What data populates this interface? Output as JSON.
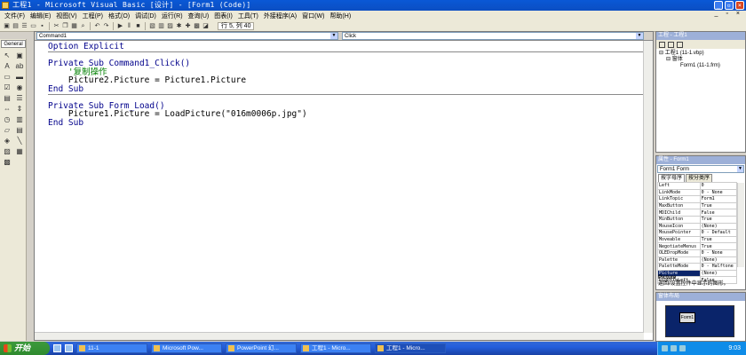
{
  "window": {
    "title": "工程1 - Microsoft Visual Basic [设计] - [Form1 (Code)]"
  },
  "menu": [
    "文件(F)",
    "编辑(E)",
    "视图(V)",
    "工程(P)",
    "格式(O)",
    "调试(D)",
    "运行(R)",
    "查询(U)",
    "图表(I)",
    "工具(T)",
    "外接程序(A)",
    "窗口(W)",
    "帮助(H)"
  ],
  "toolbar": {
    "position": "行 5, 列 40"
  },
  "toolbox": {
    "title": "General"
  },
  "code": {
    "object_combo": "Command1",
    "proc_combo": "Click",
    "lines": {
      "l1": "Option Explicit",
      "l2": "Private Sub Command1_Click()",
      "l3": "    '复制操作",
      "l4": "    Picture2.Picture = Picture1.Picture",
      "l5": "End Sub",
      "l6": "Private Sub Form_Load()",
      "l7": "    Picture1.Picture = LoadPicture(\"016m0006p.jpg\")",
      "l8": "End Sub"
    }
  },
  "project": {
    "title": "工程 - 工程1",
    "root": "工程1 (11-1.vbp)",
    "folder": "窗体",
    "form": "Form1 (11-1.frm)"
  },
  "properties": {
    "title": "属性 - Form1",
    "object": "Form1 Form",
    "tab1": "按字母序",
    "tab2": "按分类序",
    "rows": [
      [
        "Left",
        "0"
      ],
      [
        "LinkMode",
        "0 - None"
      ],
      [
        "LinkTopic",
        "Form1"
      ],
      [
        "MaxButton",
        "True"
      ],
      [
        "MDIChild",
        "False"
      ],
      [
        "MinButton",
        "True"
      ],
      [
        "MouseIcon",
        "(None)"
      ],
      [
        "MousePointer",
        "0 - Default"
      ],
      [
        "Moveable",
        "True"
      ],
      [
        "NegotiateMenus",
        "True"
      ],
      [
        "OLEDropMode",
        "0 - None"
      ],
      [
        "Palette",
        "(None)"
      ],
      [
        "PaletteMode",
        "0 - Halftone"
      ],
      [
        "Picture",
        "(None)"
      ],
      [
        "RightToLeft",
        "False"
      ]
    ],
    "selected_index": 13,
    "desc_title": "Picture",
    "desc_text": "返回/设置控件中显示的图形。"
  },
  "layout": {
    "title": "窗体布局",
    "form_label": "Form1"
  },
  "taskbar": {
    "start": "开始",
    "tasks": [
      "11-1",
      "Microsoft Pow...",
      "PowerPoint 幻...",
      "工程1 - Micro...",
      "工程1 - Micro..."
    ],
    "clock": "9:03"
  }
}
